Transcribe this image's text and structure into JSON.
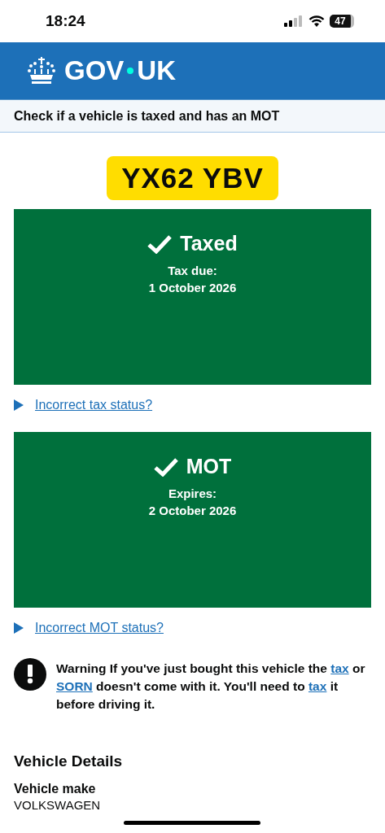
{
  "status_bar": {
    "time": "18:24",
    "battery": "47"
  },
  "header": {
    "logo": "GOV",
    "logo_2": "UK"
  },
  "service_name": "Check if a vehicle is taxed and has an MOT",
  "registration": "YX62 YBV",
  "statuses": [
    {
      "title": "Taxed",
      "valid": true,
      "label": "Tax due:",
      "date": "1 October 2026",
      "link": "Incorrect tax status?"
    },
    {
      "title": "MOT",
      "valid": true,
      "label": "Expires:",
      "date": "2 October 2026",
      "link": "Incorrect MOT status?"
    }
  ],
  "warning": [
    {
      "text": "Warning If you've just bought this vehicle the ",
      "link": false
    },
    {
      "text": "tax",
      "link": true
    },
    {
      "text": " or ",
      "link": false
    },
    {
      "text": "SORN",
      "link": true
    },
    {
      "text": " doesn't come with it. You'll need to ",
      "link": false
    },
    {
      "text": "tax",
      "link": true
    },
    {
      "text": " it before driving it.",
      "link": false
    }
  ],
  "details": {
    "heading": "Vehicle Details",
    "items": [
      {
        "label": "Vehicle make",
        "value": "VOLKSWAGEN"
      }
    ]
  }
}
